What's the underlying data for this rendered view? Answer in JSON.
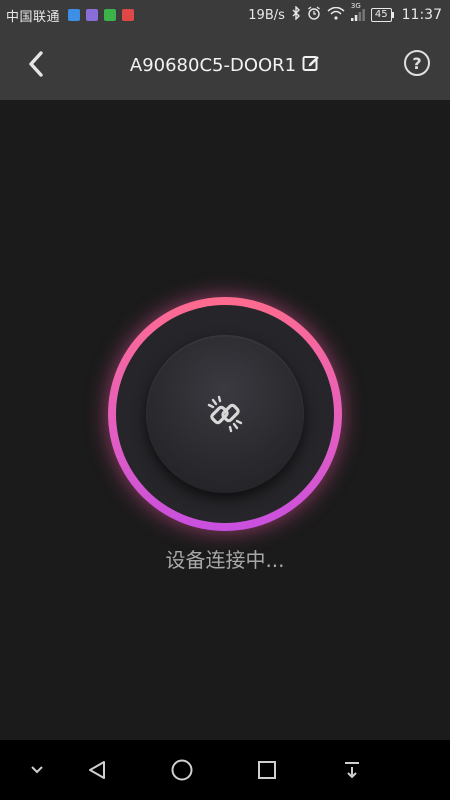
{
  "status_bar": {
    "carrier": "中国联通",
    "notification_icons": [
      {
        "name": "message-app-icon",
        "color": "#3d8fe6"
      },
      {
        "name": "gallery-app-icon",
        "color": "#8a6ed8"
      },
      {
        "name": "wechat-icon",
        "color": "#3cb34a"
      },
      {
        "name": "home-app-icon",
        "color": "#e04848"
      }
    ],
    "net_speed": "19B/s",
    "network_type": "3G",
    "battery": "45",
    "time": "11:37"
  },
  "header": {
    "title": "A90680C5-DOOR1",
    "back_icon": "chevron-left-icon",
    "edit_icon": "edit-icon",
    "help_label": "?"
  },
  "main": {
    "connect_icon": "broken-link-icon",
    "status_text": "设备连接中...",
    "ring_colors": [
      "#ff6b8e",
      "#e45fbf",
      "#c84fe0"
    ]
  },
  "nav_bar": {
    "items": [
      "collapse-icon",
      "back-triangle-icon",
      "home-circle-icon",
      "recents-square-icon",
      "pull-down-icon"
    ]
  }
}
